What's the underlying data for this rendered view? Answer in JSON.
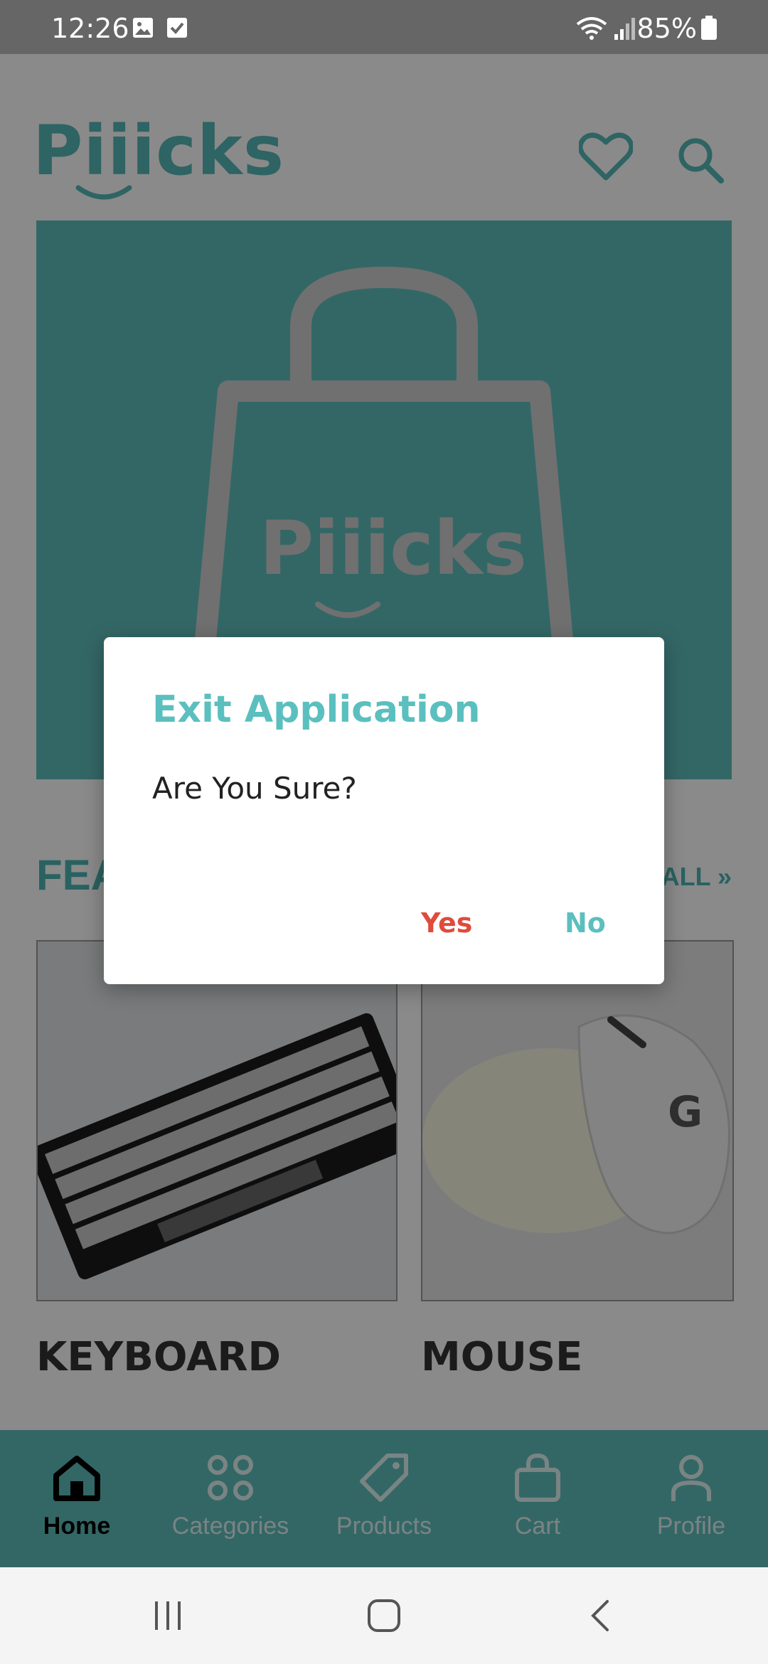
{
  "status_bar": {
    "time": "12:26",
    "battery": "85%"
  },
  "header": {
    "logo": "Piiicks",
    "favorites_icon": "heart-icon",
    "search_icon": "search-icon"
  },
  "hero": {
    "brand_text": "Piiicks"
  },
  "featured": {
    "title": "FEATURED",
    "see_all": "SEE ALL »",
    "products": [
      {
        "name": "KEYBOARD"
      },
      {
        "name": "MOUSE"
      }
    ]
  },
  "bottom_nav": {
    "items": [
      {
        "label": "Home",
        "icon": "home-icon",
        "active": true
      },
      {
        "label": "Categories",
        "icon": "categories-icon"
      },
      {
        "label": "Products",
        "icon": "tag-icon"
      },
      {
        "label": "Cart",
        "icon": "cart-icon"
      },
      {
        "label": "Profile",
        "icon": "profile-icon"
      }
    ]
  },
  "dialog": {
    "title": "Exit Application",
    "message": "Are You Sure?",
    "confirm_label": "Yes",
    "cancel_label": "No"
  },
  "colors": {
    "accent": "#5bbfbf",
    "danger": "#e04b3c"
  }
}
